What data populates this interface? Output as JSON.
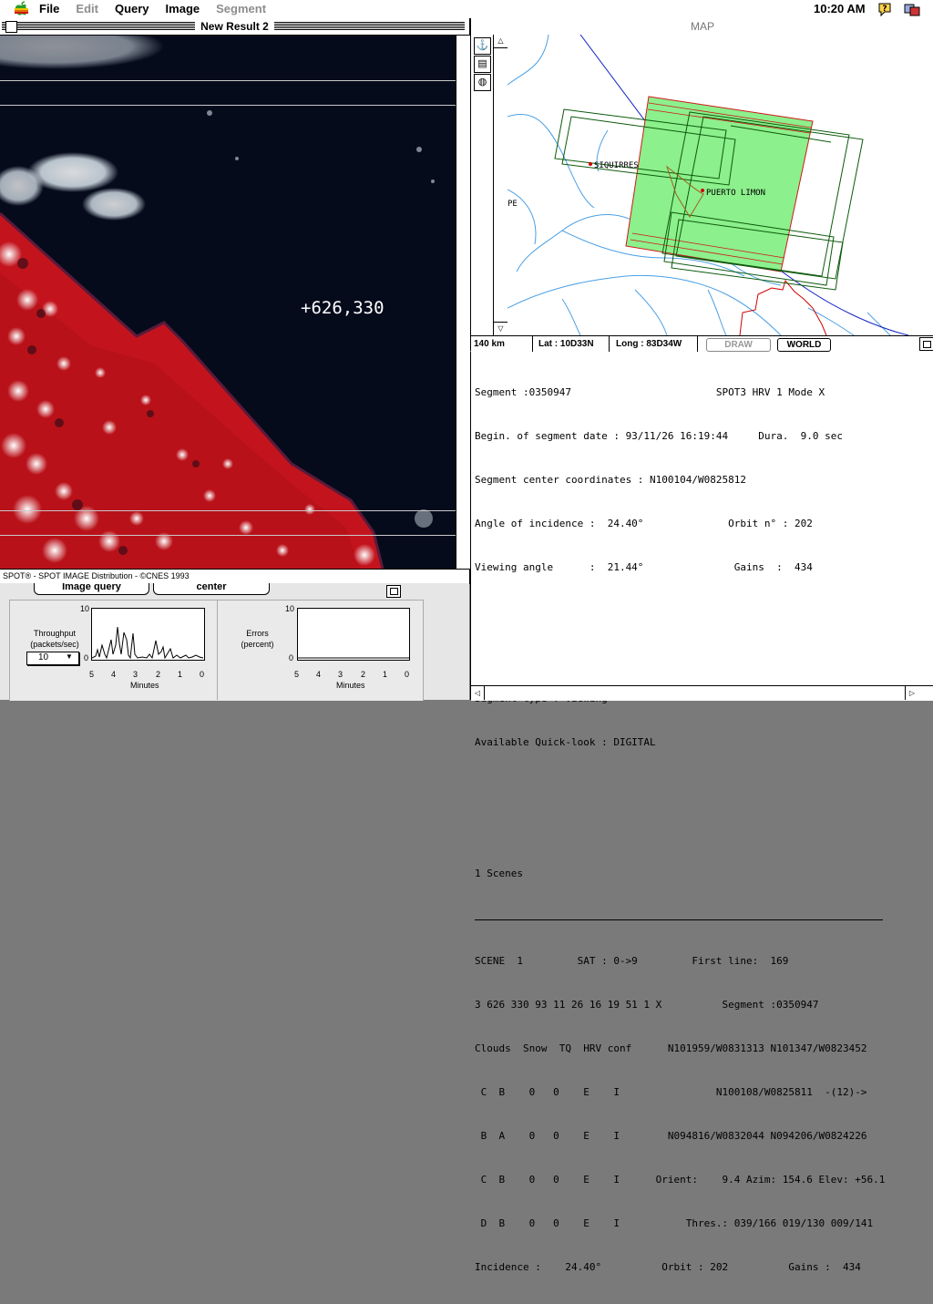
{
  "menubar": {
    "items": [
      {
        "label": "File",
        "enabled": true
      },
      {
        "label": "Edit",
        "enabled": false
      },
      {
        "label": "Query",
        "enabled": true
      },
      {
        "label": "Image",
        "enabled": true
      },
      {
        "label": "Segment",
        "enabled": false
      }
    ],
    "clock": "10:20 AM"
  },
  "image_window": {
    "title": "New Result 2",
    "coordinate_label": "+626,330",
    "caption": "SPOT® - SPOT IMAGE Distribution - ©CNES 1993"
  },
  "bottom_panel": {
    "image_query_button": "Image query",
    "center_button": "center",
    "throughput": {
      "label_line1": "Throughput",
      "label_line2": "(packets/sec)",
      "select_value": "10",
      "y_max": "10",
      "y_min": "0",
      "x_ticks": [
        "5",
        "4",
        "3",
        "2",
        "1",
        "0"
      ],
      "x_label": "Minutes"
    },
    "errors": {
      "label_line1": "Errors",
      "label_line2": "(percent)",
      "y_max": "10",
      "y_min": "0",
      "x_ticks": [
        "5",
        "4",
        "3",
        "2",
        "1",
        "0"
      ],
      "x_label": "Minutes"
    }
  },
  "map_window": {
    "title": "MAP",
    "places": {
      "siquirres": "SIQUIRRES",
      "puerto_limon": "PUERTO LIMON",
      "pe": "PE"
    },
    "status": {
      "scale": "140 km",
      "lat": "Lat : 10D33N",
      "long": "Long : 83D34W",
      "draw_button": "DRAW",
      "world_button": "WORLD"
    }
  },
  "info_window": {
    "lines": [
      "Segment :0350947                        SPOT3 HRV 1 Mode X",
      "Begin. of segment date : 93/11/26 16:19:44     Dura.  9.0 sec",
      "Segment center coordinates : N100104/W0825812",
      "Angle of incidence :  24.40°              Orbit n° : 202",
      "Viewing angle      :  21.44°               Gains  :  434",
      "",
      "",
      "Segment type : Viewing",
      "Available Quick-look : DIGITAL",
      "",
      "",
      "1 Scenes",
      "",
      "SCENE  1         SAT : 0->9         First line:  169",
      "3 626 330 93 11 26 16 19 51 1 X          Segment :0350947",
      "Clouds  Snow  TQ  HRV conf      N101959/W0831313 N101347/W0823452",
      " C  B    0   0    E    I                N100108/W0825811  -(12)->",
      " B  A    0   0    E    I        N094816/W0832044 N094206/W0824226",
      " C  B    0   0    E    I      Orient:    9.4 Azim: 154.6 Elev: +56.1",
      " D  B    0   0    E    I           Thres.: 039/166 019/130 009/141",
      "Incidence :    24.40°          Orbit : 202          Gains :  434"
    ]
  }
}
